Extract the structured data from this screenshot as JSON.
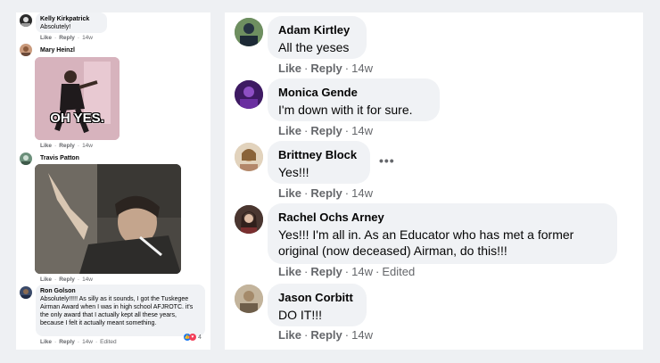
{
  "left_panel": {
    "comments": [
      {
        "name": "Kelly Kirkpatrick",
        "text": "Absolutely!",
        "like": "Like",
        "reply": "Reply",
        "time": "14w"
      },
      {
        "name": "Mary Heinzl",
        "like": "Like",
        "reply": "Reply",
        "time": "14w",
        "gif_caption": "OH YES."
      },
      {
        "name": "Travis Patton",
        "like": "Like",
        "reply": "Reply",
        "time": "14w"
      },
      {
        "name": "Ron Golson",
        "text": "Absolutely!!!!! As silly as it sounds, I got the Tuskegee Airman Award when I was in high school AFJROTC. it's the only award that I actually kept all these years, because I felt it actually meant something.",
        "like": "Like",
        "reply": "Reply",
        "time": "14w",
        "edited": "Edited",
        "reaction_count": "4"
      }
    ]
  },
  "right_panel": {
    "comments": [
      {
        "name": "Adam Kirtley",
        "text": "All the yeses",
        "like": "Like",
        "reply": "Reply",
        "time": "14w"
      },
      {
        "name": "Monica Gende",
        "text": "I'm down with it for sure.",
        "like": "Like",
        "reply": "Reply",
        "time": "14w"
      },
      {
        "name": "Brittney Block",
        "text": "Yes!!!",
        "like": "Like",
        "reply": "Reply",
        "time": "14w",
        "more": "•••"
      },
      {
        "name": "Rachel Ochs Arney",
        "text": "Yes!!! I'm all in. As an Educator who has met a former original (now deceased) Airman, do this!!!",
        "like": "Like",
        "reply": "Reply",
        "time": "14w",
        "edited": "Edited"
      },
      {
        "name": "Jason Corbitt",
        "text": "DO IT!!!",
        "like": "Like",
        "reply": "Reply",
        "time": "14w"
      }
    ]
  },
  "colors": {
    "bubble": "#f0f2f5",
    "meta": "#65676b",
    "like_blue": "#1877f2",
    "heart_red": "#f33e58"
  }
}
